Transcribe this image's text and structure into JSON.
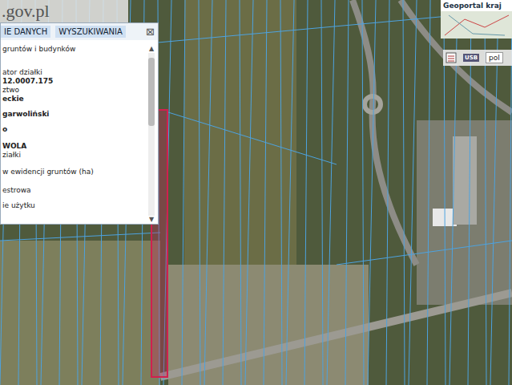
{
  "logo": {
    "text": ".gov.pl"
  },
  "panel": {
    "tabs": [
      {
        "label": "IE DANYCH",
        "selected": false
      },
      {
        "label": "WYSZUKIWANIA",
        "selected": false
      }
    ],
    "close": "⊠",
    "lines": [
      {
        "text": "gruntów i budynków",
        "kind": "label"
      },
      {
        "text": "ator działki",
        "kind": "label"
      },
      {
        "text": "12.0007.175",
        "kind": "value"
      },
      {
        "text": "ztwo",
        "kind": "label"
      },
      {
        "text": "eckie",
        "kind": "value"
      },
      {
        "text": "garwoliński",
        "kind": "value"
      },
      {
        "text": "o",
        "kind": "value"
      },
      {
        "text": "WOLA",
        "kind": "value"
      },
      {
        "text": "ziałki",
        "kind": "label"
      },
      {
        "text": "w ewidencji gruntów (ha)",
        "kind": "label"
      },
      {
        "text": "estrowa",
        "kind": "label"
      },
      {
        "text": "ie użytku",
        "kind": "label"
      }
    ],
    "scroll_up": "▲",
    "scroll_down": "▼"
  },
  "overview": {
    "title": "Geoportal kraj"
  },
  "toolbar": {
    "usb_label": "USB",
    "language": "pol"
  }
}
